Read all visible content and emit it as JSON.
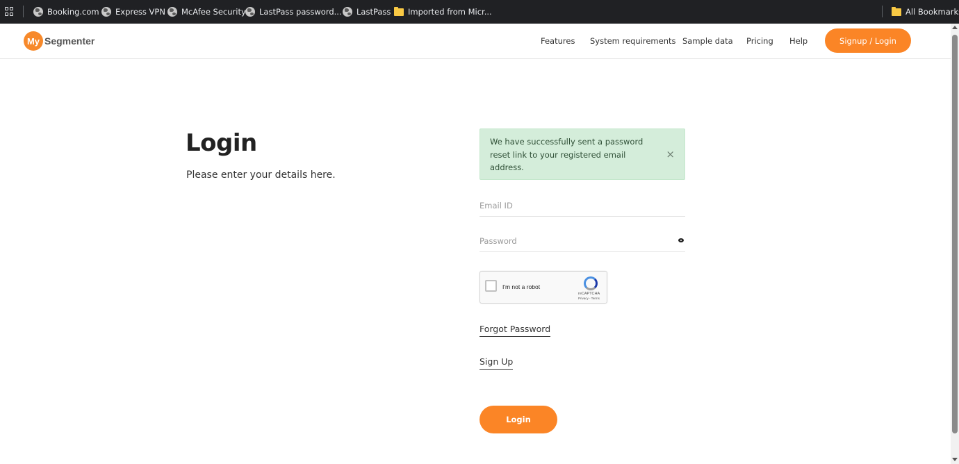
{
  "bookmarks": {
    "items": [
      {
        "label": "Booking.com",
        "icon": "globe-icon"
      },
      {
        "label": "Express VPN",
        "icon": "globe-icon"
      },
      {
        "label": "McAfee Security",
        "icon": "globe-icon"
      },
      {
        "label": "LastPass password...",
        "icon": "globe-icon"
      },
      {
        "label": "LastPass",
        "icon": "globe-icon"
      },
      {
        "label": "Imported from Micr...",
        "icon": "folder-icon"
      }
    ],
    "all_bookmarks": "All Bookmarks"
  },
  "header": {
    "logo_mark": "My",
    "logo_text": "Segmenter",
    "nav": [
      "Features",
      "System requirements",
      "Sample data",
      "Pricing",
      "Help"
    ],
    "signup_label": "Signup / Login"
  },
  "main": {
    "title": "Login",
    "subtitle": "Please enter your details here.",
    "alert": {
      "message": "We have successfully sent a password reset link to your registered email address.",
      "close": "×"
    },
    "email_placeholder": "Email ID",
    "password_placeholder": "Password",
    "captcha": {
      "label": "I'm not a robot",
      "brand": "reCAPTCHA",
      "terms": "Privacy - Terms"
    },
    "forgot_password": "Forgot Password",
    "sign_up": "Sign Up",
    "login_button": "Login"
  },
  "colors": {
    "accent": "#fb8526",
    "alert_bg": "#d4edda",
    "bookmarks_bg": "#202124"
  }
}
